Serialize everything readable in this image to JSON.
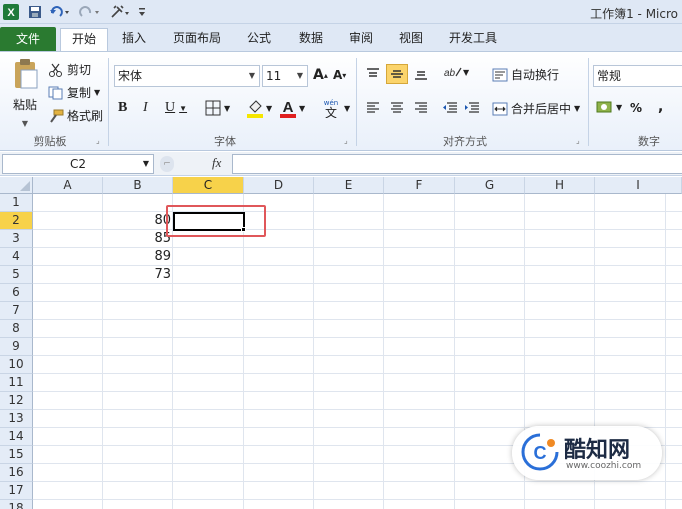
{
  "titlebar": {
    "title": "工作簿1 - Micro",
    "quick_access": [
      "save-icon",
      "undo-icon",
      "redo-icon",
      "format-brush-icon",
      "customize-icon"
    ]
  },
  "tabs": [
    "文件",
    "开始",
    "插入",
    "页面布局",
    "公式",
    "数据",
    "审阅",
    "视图",
    "开发工具"
  ],
  "ribbon": {
    "clipboard": {
      "paste": "粘贴",
      "cut": "剪切",
      "copy": "复制",
      "format_painter": "格式刷",
      "group": "剪贴板"
    },
    "font": {
      "name": "宋体",
      "size": "11",
      "bold": "B",
      "italic": "I",
      "underline": "U",
      "grow": "A",
      "shrink": "A",
      "wen": "wén",
      "group": "字体"
    },
    "alignment": {
      "wrap": "自动换行",
      "merge": "合并后居中",
      "group": "对齐方式"
    },
    "number": {
      "format": "常规",
      "percent": "%",
      "comma": ",",
      "group": "数字"
    }
  },
  "formula_bar": {
    "name_box": "C2",
    "fx": "fx",
    "value": ""
  },
  "sheet": {
    "columns": [
      "A",
      "B",
      "C",
      "D",
      "E",
      "F",
      "G",
      "H",
      "I"
    ],
    "rows": [
      "1",
      "2",
      "3",
      "4",
      "5",
      "6",
      "7",
      "8",
      "9",
      "10",
      "11",
      "12",
      "13",
      "14",
      "15",
      "16",
      "17",
      "18"
    ],
    "values_b": {
      "2": "80",
      "3": "85",
      "4": "89",
      "5": "73"
    },
    "active_cell": "C2"
  },
  "watermark": {
    "name": "酷知网",
    "url": "www.coozhi.com"
  },
  "colors": {
    "file_tab": "#2a7a30",
    "active_header": "#f7d24a",
    "highlight": "#e0575a"
  }
}
